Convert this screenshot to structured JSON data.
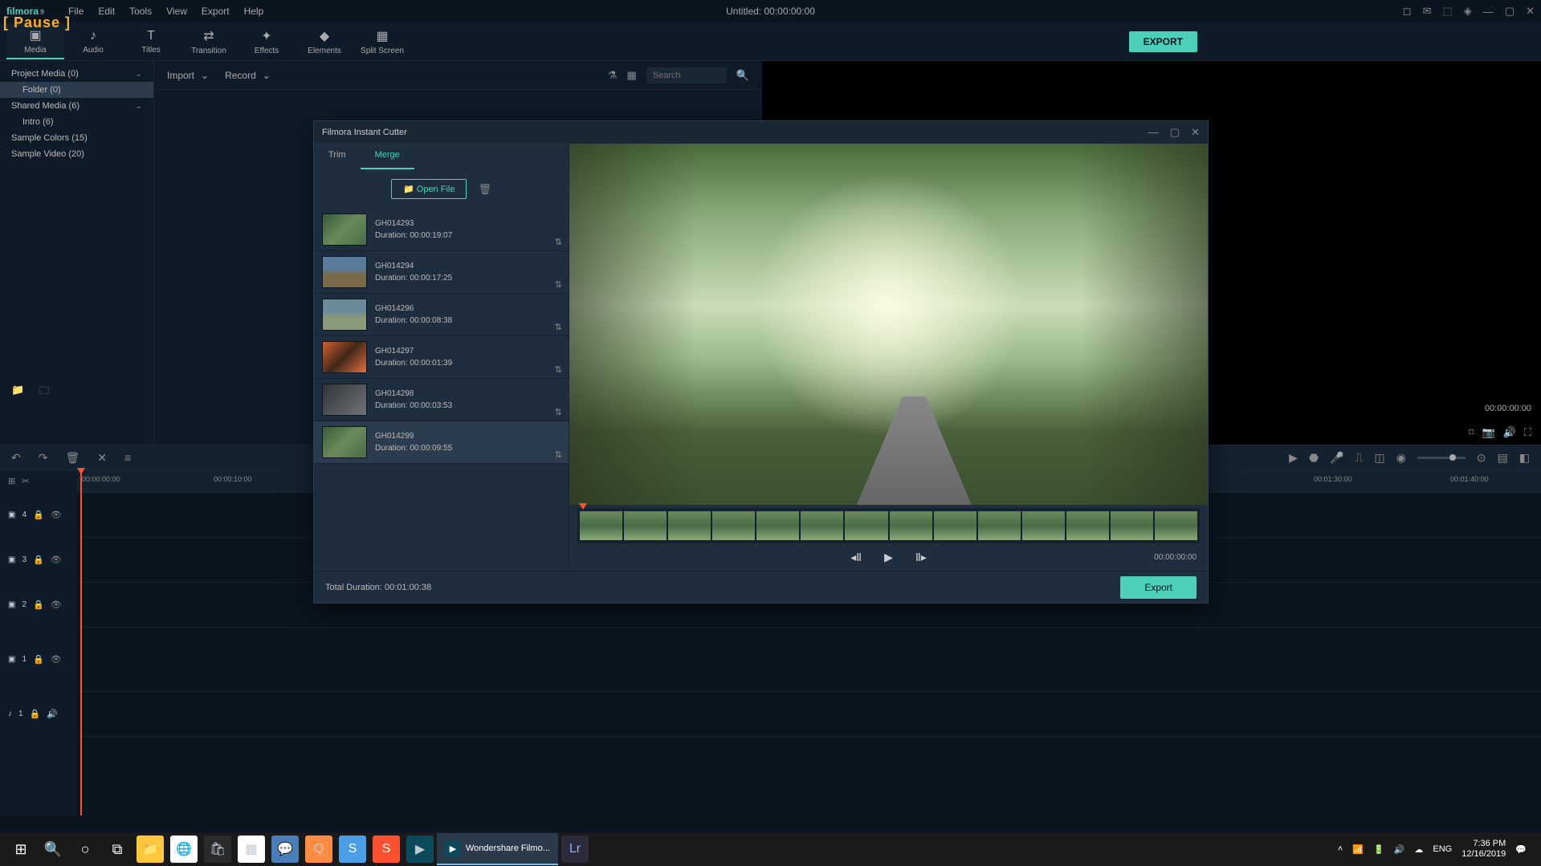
{
  "titlebar": {
    "logo": "filmora",
    "logo_sub": "9",
    "pause_badge": "[ Pause ]",
    "menus": [
      "File",
      "Edit",
      "Tools",
      "View",
      "Export",
      "Help"
    ],
    "project_title": "Untitled:",
    "project_time": "00:00:00:00"
  },
  "tooltabs": {
    "items": [
      "Media",
      "Audio",
      "Titles",
      "Transition",
      "Effects",
      "Elements",
      "Split Screen"
    ],
    "export_label": "EXPORT"
  },
  "sidebar": {
    "items": [
      {
        "label": "Project Media (0)",
        "expandable": true
      },
      {
        "label": "Folder (0)",
        "child": true,
        "active": true
      },
      {
        "label": "Shared Media (6)",
        "expandable": true
      },
      {
        "label": "Intro (6)",
        "child": true
      },
      {
        "label": "Sample Colors (15)"
      },
      {
        "label": "Sample Video (20)"
      }
    ]
  },
  "media_toolbar": {
    "import_label": "Import",
    "record_label": "Record",
    "search_placeholder": "Search"
  },
  "preview": {
    "time_right": "00:00:00:00"
  },
  "timeline": {
    "ticks": [
      "00:00:00:00",
      "00:00:10:00",
      "",
      "",
      "",
      "",
      "",
      "",
      "",
      "00:01:30:00",
      "00:01:40:00"
    ],
    "tracks": [
      {
        "label": "4"
      },
      {
        "label": "3"
      },
      {
        "label": "2"
      },
      {
        "label": "1"
      },
      {
        "label": "1",
        "audio": true
      }
    ]
  },
  "modal": {
    "title": "Filmora Instant Cutter",
    "tabs": {
      "trim": "Trim",
      "merge": "Merge"
    },
    "open_file": "Open File",
    "clips": [
      {
        "name": "GH014293",
        "duration": "Duration: 00:00:19:07",
        "thumb_class": "t1"
      },
      {
        "name": "GH014294",
        "duration": "Duration: 00:00:17:25",
        "thumb_class": "t2"
      },
      {
        "name": "GH014296",
        "duration": "Duration: 00:00:08:38",
        "thumb_class": "t3"
      },
      {
        "name": "GH014297",
        "duration": "Duration: 00:00:01:39",
        "thumb_class": "t4"
      },
      {
        "name": "GH014298",
        "duration": "Duration: 00:00:03:53",
        "thumb_class": "t5"
      },
      {
        "name": "GH014299",
        "duration": "Duration: 00:00:09:55",
        "thumb_class": "t1"
      }
    ],
    "playback_time": "00:00:00:00",
    "total_duration_label": "Total Duration:",
    "total_duration_value": "00:01:00:38",
    "export_label": "Export"
  },
  "taskbar": {
    "active_app": "Wondershare Filmo...",
    "lang": "ENG",
    "time": "7:36 PM",
    "date": "12/16/2019"
  }
}
